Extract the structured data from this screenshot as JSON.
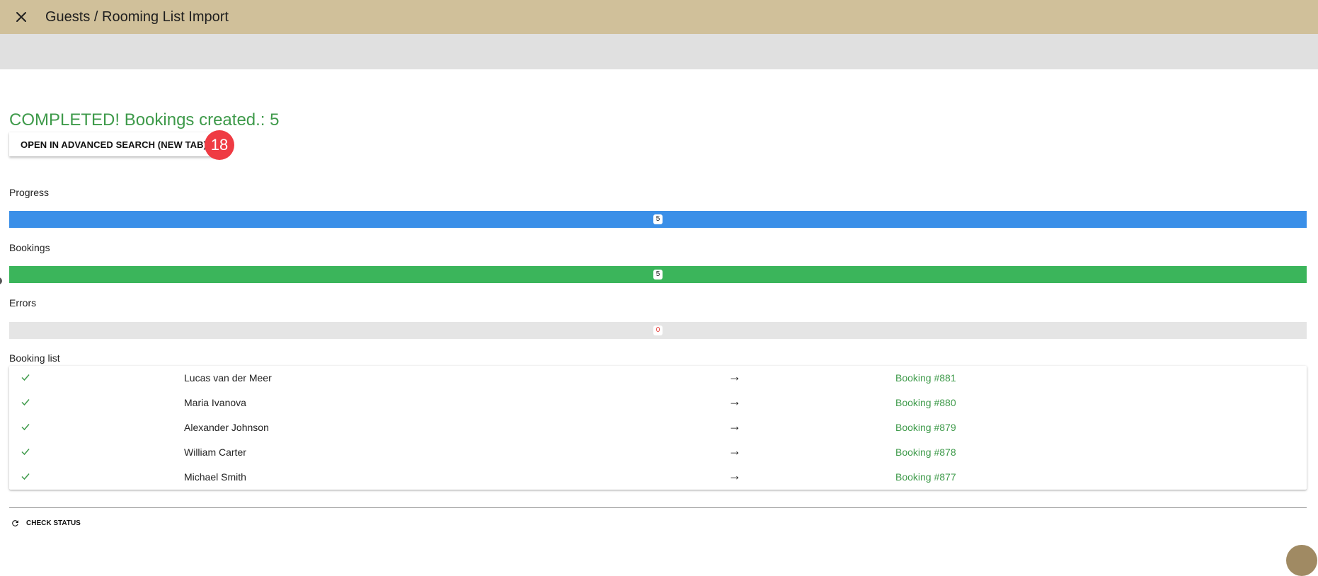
{
  "header": {
    "title": "Guests / Rooming List Import",
    "close_icon": "close-icon"
  },
  "status": {
    "completed_text": "COMPLETED! Bookings created.: 5",
    "advanced_search_label": "OPEN IN ADVANCED SEARCH (NEW TAB)",
    "badge_count": "18"
  },
  "progress": {
    "label": "Progress",
    "count": "5",
    "fill_fraction": 1.0,
    "color": "#3a8fe8"
  },
  "bookings": {
    "label": "Bookings",
    "count": "5",
    "fill_fraction": 1.0,
    "color": "#3bb55b"
  },
  "errors": {
    "label": "Errors",
    "count": "0",
    "fill_fraction": 0.0,
    "color": "#e53935",
    "track_color": "#e5e5e5"
  },
  "booking_list": {
    "label": "Booking list",
    "arrow": "→",
    "rows": [
      {
        "guest": "Lucas van der Meer",
        "booking": "Booking #881"
      },
      {
        "guest": "Maria Ivanova",
        "booking": "Booking #880"
      },
      {
        "guest": "Alexander Johnson",
        "booking": "Booking #879"
      },
      {
        "guest": "William Carter",
        "booking": "Booking #878"
      },
      {
        "guest": "Michael Smith",
        "booking": "Booking #877"
      }
    ]
  },
  "footer": {
    "check_status_label": "CHECK STATUS",
    "refresh_icon": "refresh-icon"
  },
  "colors": {
    "header_bg": "#d0c09a",
    "subbar_bg": "#e0e0e0",
    "success_green": "#3e9a4a",
    "badge_red": "#ef3b43"
  }
}
